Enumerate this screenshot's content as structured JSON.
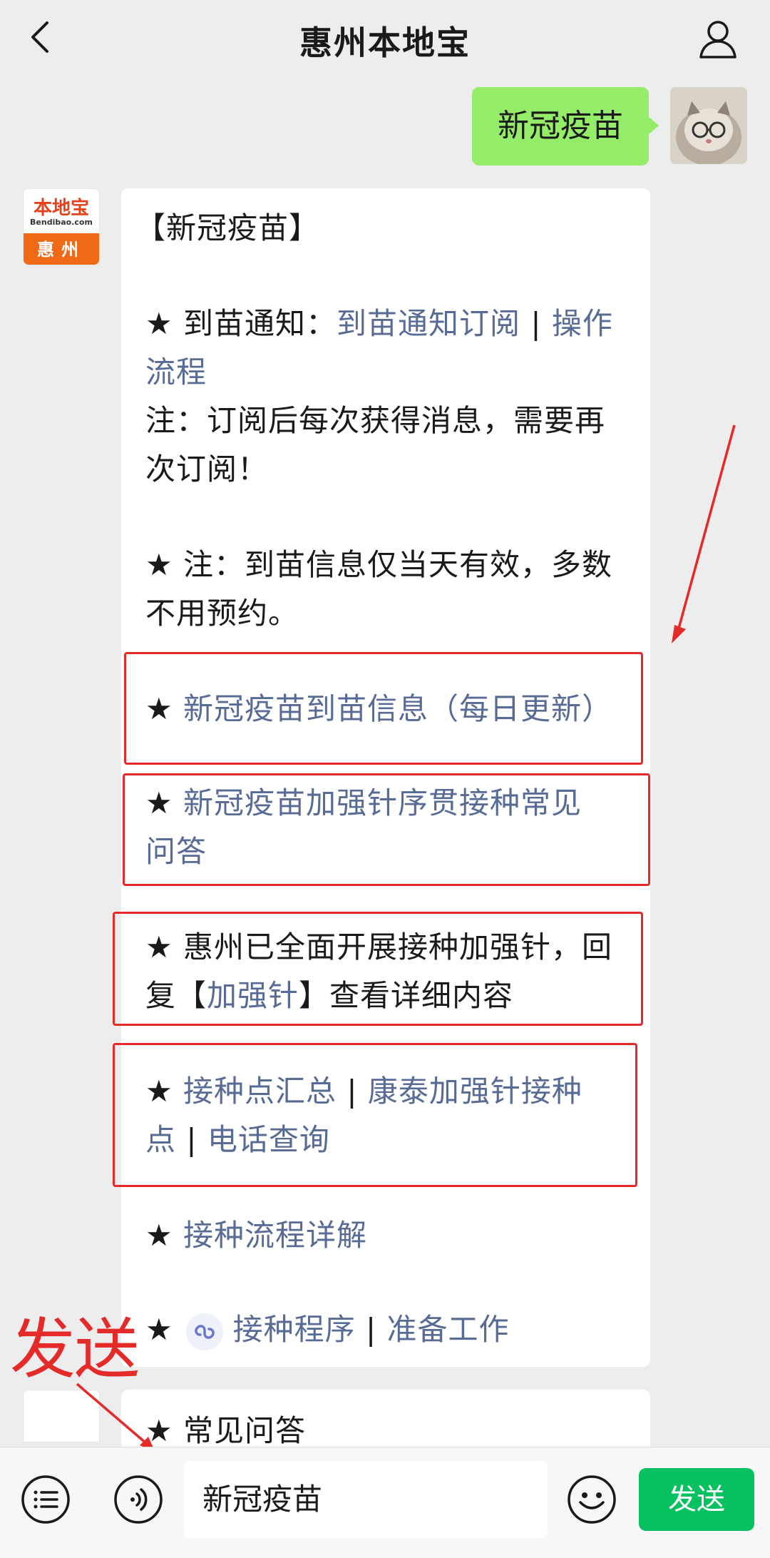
{
  "header": {
    "title": "惠州本地宝"
  },
  "sent_message": {
    "text": "新冠疫苗"
  },
  "bot": {
    "logo_text": "本地宝",
    "logo_url": "Bendibao.com",
    "logo_city": "惠州"
  },
  "reply": {
    "heading": "【新冠疫苗】",
    "line1_prefix": "★ 到苗通知：",
    "line1_link1": "到苗通知订阅",
    "sep": "|",
    "line1_link2_a": "操作",
    "line1_link2_b": "流程",
    "note1_a": "注：订阅后每次获得消息，需要再",
    "note1_b": "次订阅！",
    "note2_a": "★ 注：到苗信息仅当天有效，多数",
    "note2_b": "不用预约。",
    "star": "★",
    "item1_link": "新冠疫苗到苗信息（每日更新）",
    "item2_link_a": "新冠疫苗加强针序贯接种常见",
    "item2_link_b": "问答",
    "item3_a": "★ 惠州已全面开展接种加强针，回",
    "item3_b_prefix": "复【",
    "item3_b_link": "加强针",
    "item3_b_suffix": "】查看详细内容",
    "item4_link1": "接种点汇总",
    "item4_link2_a": "康泰加强针接种",
    "item4_link2_b": "点",
    "item4_link3": "电话查询",
    "item5_link": "接种流程详解",
    "item6_link1": "接种程序",
    "item6_link2": "准备工作",
    "item7": "★ 常见问答"
  },
  "annotation": {
    "text": "发送"
  },
  "input_bar": {
    "value": "新冠疫苗",
    "send_label": "发送"
  },
  "colors": {
    "link": "#576b95",
    "sent_bubble": "#95ec69",
    "send_button": "#07c160",
    "annotation": "#e52a2a"
  }
}
